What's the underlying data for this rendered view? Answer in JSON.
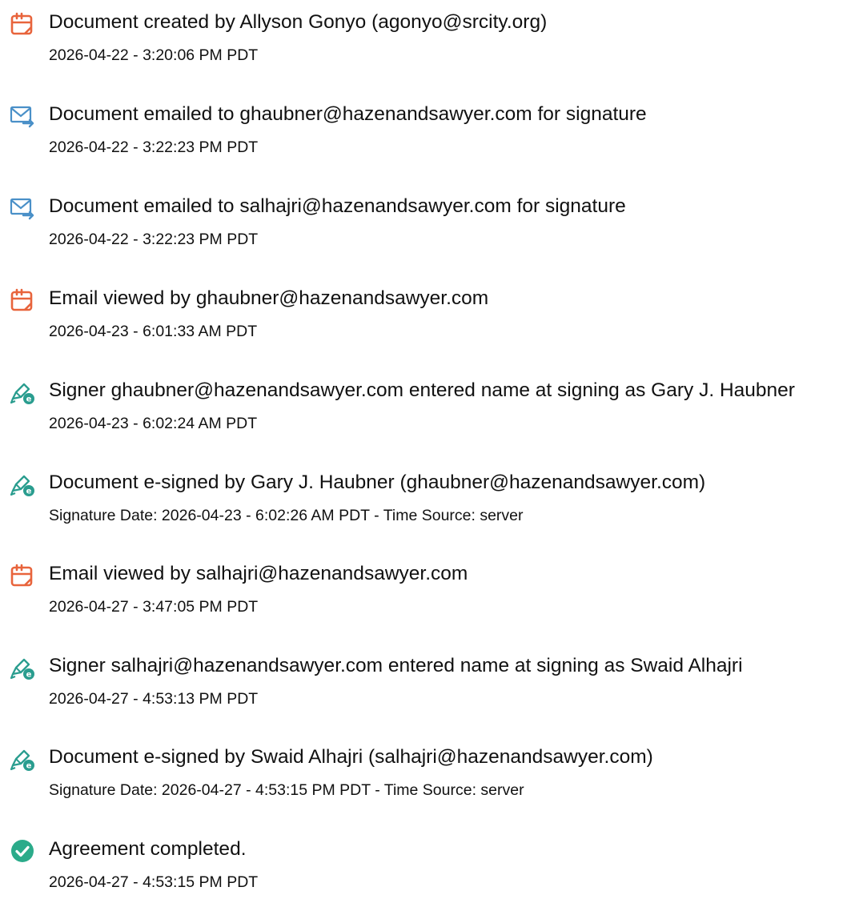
{
  "colors": {
    "document_icon": "#e8643c",
    "email_icon": "#4a90c8",
    "signature_icon": "#2a9d8f",
    "complete_icon": "#2bab8a",
    "text": "#111111"
  },
  "events": [
    {
      "icon": "document-icon",
      "title": "Document created by Allyson Gonyo (agonyo@srcity.org)",
      "time": "2026-04-22 - 3:20:06 PM PDT"
    },
    {
      "icon": "email-icon",
      "title": "Document emailed to ghaubner@hazenandsawyer.com for signature",
      "time": "2026-04-22 - 3:22:23 PM PDT"
    },
    {
      "icon": "email-icon",
      "title": "Document emailed to salhajri@hazenandsawyer.com for signature",
      "time": "2026-04-22 - 3:22:23 PM PDT"
    },
    {
      "icon": "document-icon",
      "title": "Email viewed by ghaubner@hazenandsawyer.com",
      "time": "2026-04-23 - 6:01:33 AM PDT"
    },
    {
      "icon": "signature-icon",
      "title": "Signer ghaubner@hazenandsawyer.com entered name at signing as Gary J. Haubner",
      "time": "2026-04-23 - 6:02:24 AM PDT"
    },
    {
      "icon": "signature-icon",
      "title": "Document e-signed by Gary J. Haubner (ghaubner@hazenandsawyer.com)",
      "time": "Signature Date: 2026-04-23 - 6:02:26 AM PDT - Time Source: server"
    },
    {
      "icon": "document-icon",
      "title": "Email viewed by salhajri@hazenandsawyer.com",
      "time": "2026-04-27 - 3:47:05 PM PDT"
    },
    {
      "icon": "signature-icon",
      "title": "Signer salhajri@hazenandsawyer.com entered name at signing as Swaid Alhajri",
      "time": "2026-04-27 - 4:53:13 PM PDT"
    },
    {
      "icon": "signature-icon",
      "title": "Document e-signed by Swaid Alhajri (salhajri@hazenandsawyer.com)",
      "time": "Signature Date: 2026-04-27 - 4:53:15 PM PDT - Time Source: server"
    },
    {
      "icon": "checkmark-icon",
      "title": "Agreement completed.",
      "time": "2026-04-27 - 4:53:15 PM PDT"
    }
  ]
}
